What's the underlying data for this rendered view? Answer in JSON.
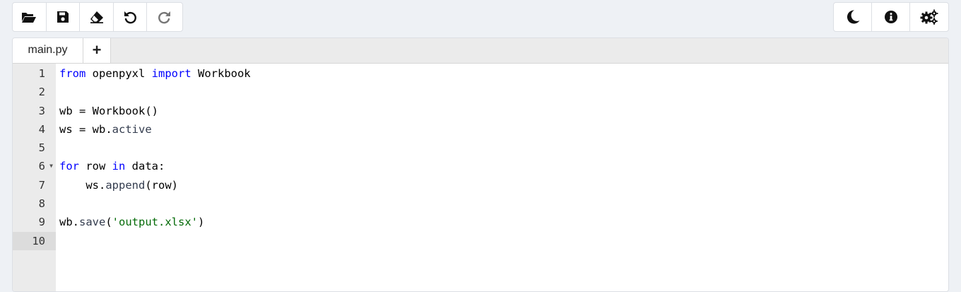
{
  "toolbar_left": {
    "buttons": [
      {
        "name": "open-folder-button",
        "icon": "folder-open-icon"
      },
      {
        "name": "save-button",
        "icon": "floppy-disk-icon"
      },
      {
        "name": "clear-button",
        "icon": "eraser-icon"
      },
      {
        "name": "undo-button",
        "icon": "undo-icon"
      },
      {
        "name": "redo-button",
        "icon": "redo-icon"
      }
    ]
  },
  "toolbar_right": {
    "buttons": [
      {
        "name": "theme-toggle-button",
        "icon": "moon-icon"
      },
      {
        "name": "info-button",
        "icon": "info-icon"
      },
      {
        "name": "settings-button",
        "icon": "gears-icon"
      }
    ]
  },
  "tabs": {
    "file_label": "main.py",
    "add_label": "+"
  },
  "editor": {
    "line_numbers": [
      "1",
      "2",
      "3",
      "4",
      "5",
      "6",
      "7",
      "8",
      "9",
      "10"
    ],
    "active_line": "10",
    "lines": {
      "l1": {
        "kw_from": "from",
        "mod": " openpyxl ",
        "kw_import": "import",
        "name": " Workbook"
      },
      "l3": {
        "text": "wb = Workbook()"
      },
      "l4": {
        "pre": "ws = wb.",
        "prop": "active"
      },
      "l6": {
        "kw_for": "for",
        "mid": " row ",
        "kw_in": "in",
        "rest": " data:"
      },
      "l7": {
        "pre": "    ws.",
        "prop": "append",
        "rest": "(row)"
      },
      "l9": {
        "pre": "wb.",
        "prop": "save",
        "open": "(",
        "str": "'output.xlsx'",
        "close": ")"
      }
    }
  },
  "colors": {
    "keyword": "#0000ff",
    "string": "#036a07",
    "property": "#333c4e",
    "gutter": "#ebebeb",
    "background": "#eef1f5"
  }
}
